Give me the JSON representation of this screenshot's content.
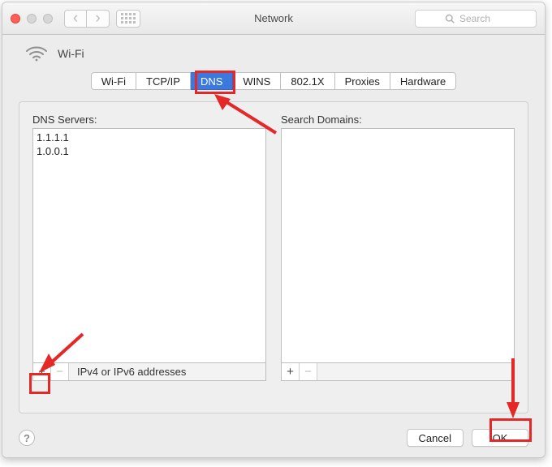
{
  "window": {
    "title": "Network"
  },
  "search": {
    "placeholder": "Search"
  },
  "connection": {
    "name": "Wi-Fi"
  },
  "tabs": [
    {
      "label": "Wi-Fi"
    },
    {
      "label": "TCP/IP"
    },
    {
      "label": "DNS",
      "active": true
    },
    {
      "label": "WINS"
    },
    {
      "label": "802.1X"
    },
    {
      "label": "Proxies"
    },
    {
      "label": "Hardware"
    }
  ],
  "dns": {
    "label": "DNS Servers:",
    "servers": [
      "1.1.1.1",
      "1.0.0.1"
    ],
    "footer_caption": "IPv4 or IPv6 addresses"
  },
  "search_domains": {
    "label": "Search Domains:",
    "items": []
  },
  "buttons": {
    "cancel": "Cancel",
    "ok": "OK"
  },
  "help_glyph": "?"
}
